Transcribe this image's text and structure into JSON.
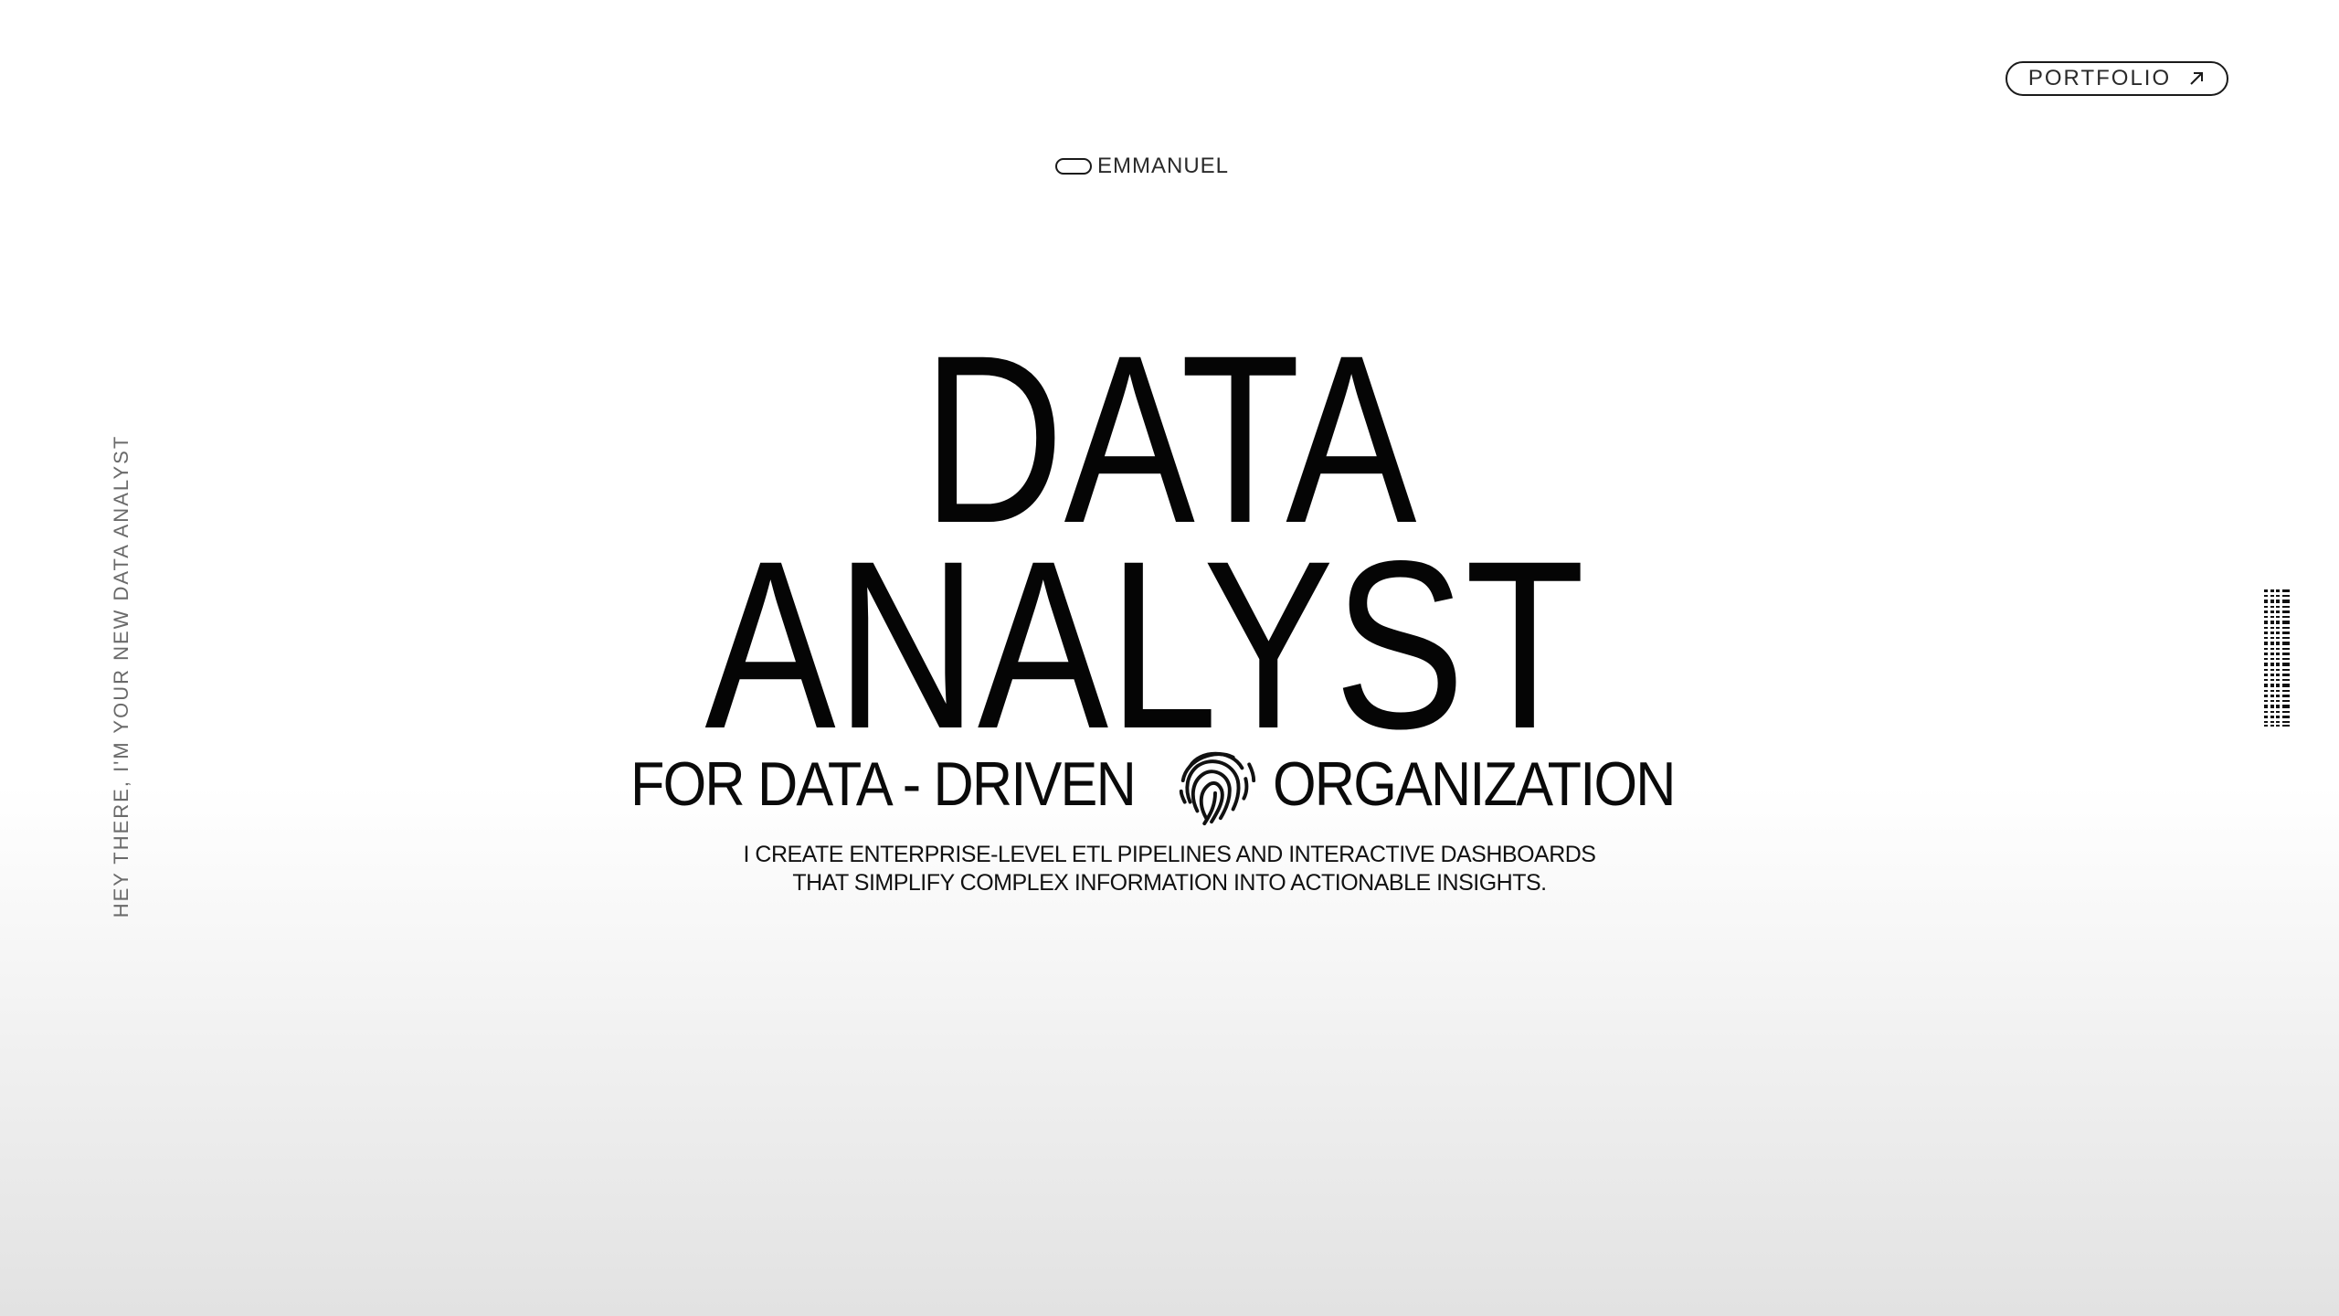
{
  "nav": {
    "portfolio_label": "PORTFOLIO",
    "portfolio_icon": "arrow-up-right-icon"
  },
  "brand": {
    "name": "EMMANUEL",
    "icon": "pill-outline-icon"
  },
  "side_text": "HEY THERE, I'M YOUR NEW DATA ANALYST",
  "hero": {
    "line1": "DATA",
    "line2": "ANALYST",
    "tagline_left": "FOR DATA - DRIVEN",
    "tagline_icon": "fingerprint-icon",
    "tagline_right": "ORGANIZATION",
    "description_line1": "I CREATE ENTERPRISE-LEVEL ETL PIPELINES AND INTERACTIVE DASHBOARDS",
    "description_line2": "THAT SIMPLIFY COMPLEX INFORMATION INTO ACTIONABLE INSIGHTS."
  },
  "decor": {
    "barcode_icon": "barcode-icon"
  },
  "colors": {
    "text": "#0a0a0a",
    "muted": "#6a6a6a",
    "background_top": "#ffffff",
    "background_bottom": "#e2e2e2"
  }
}
